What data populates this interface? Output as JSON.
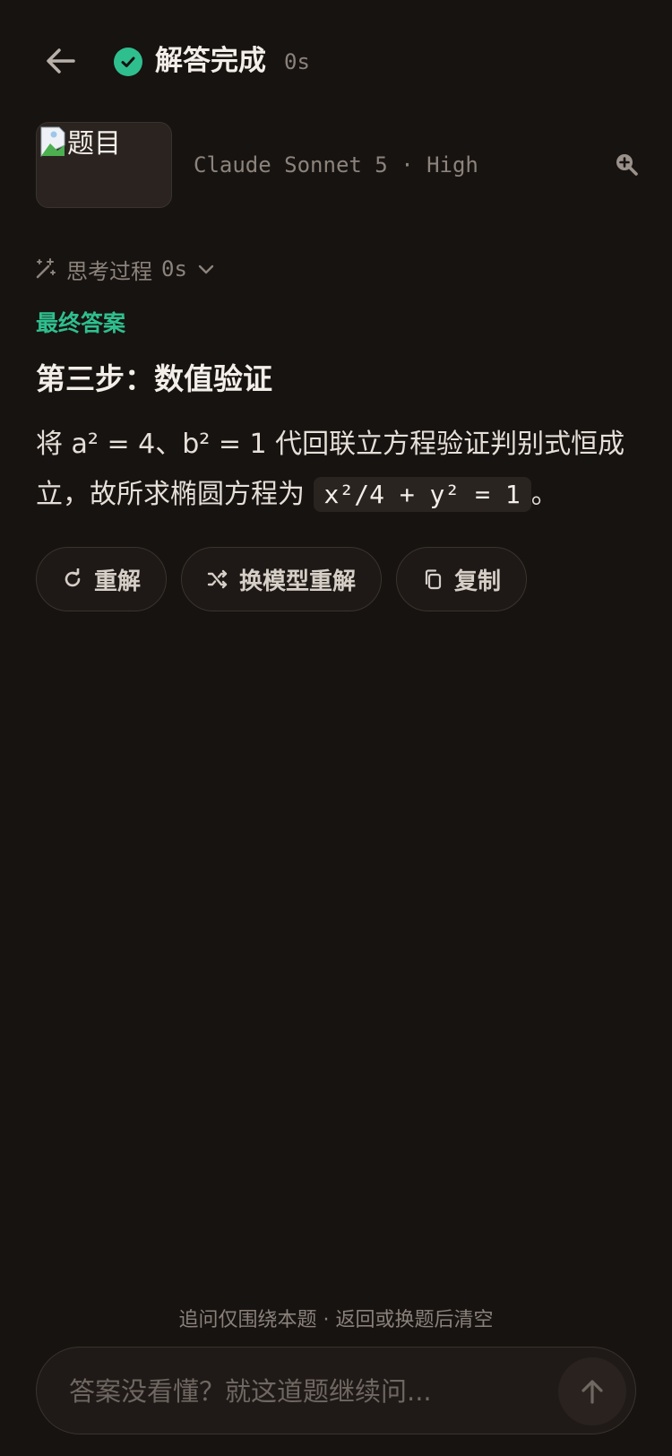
{
  "header": {
    "status_title": "解答完成",
    "status_time": "0s"
  },
  "question": {
    "thumbnail_alt": "题目",
    "model_label": "Claude Sonnet 5 · High"
  },
  "thinking": {
    "label": "思考过程",
    "time": "0s"
  },
  "answer": {
    "final_label": "最终答案",
    "step_title": "第三步：数值验证",
    "text_before": "将 a² = 4、b² = 1 代回联立方程验证判别式恒成立，故所求椭圆方程为 ",
    "code": "x²/4 + y² = 1",
    "text_after": "。"
  },
  "actions": {
    "retry_label": "重解",
    "switch_model_label": "换模型重解",
    "copy_label": "复制"
  },
  "footer": {
    "hint": "追问仅围绕本题 · 返回或换题后清空",
    "input_placeholder": "答案没看懂？就这道题继续问..."
  },
  "icons": {
    "back": "arrow-left-icon",
    "status": "check-circle-icon",
    "zoom": "zoom-in-icon",
    "thinking": "magic-wand-icon",
    "chevron": "chevron-down-icon",
    "retry": "refresh-icon",
    "shuffle": "shuffle-icon",
    "copy": "copy-icon",
    "send": "arrow-up-icon"
  },
  "colors": {
    "background": "#171311",
    "accent": "#2fbf8f"
  }
}
